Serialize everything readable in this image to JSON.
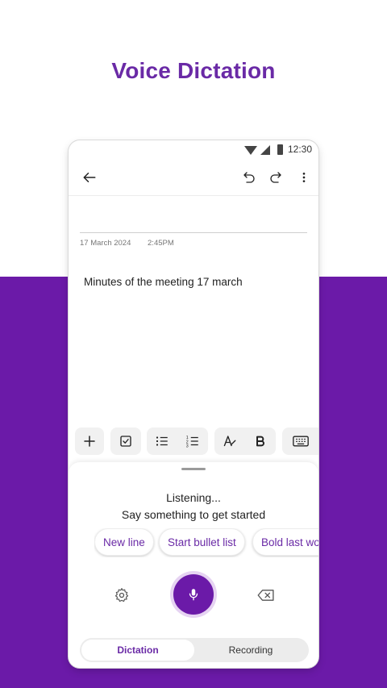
{
  "headline": "Voice Dictation",
  "status_bar": {
    "time": "12:30"
  },
  "note": {
    "date": "17 March 2024",
    "time": "2:45PM",
    "body": "Minutes of the meeting 17 march"
  },
  "dictation": {
    "status": "Listening...",
    "prompt": "Say something to get started",
    "suggestions": [
      "New line",
      "Start bullet list",
      "Bold last wo"
    ]
  },
  "mode_tabs": {
    "active": "Dictation",
    "inactive": "Recording"
  },
  "colors": {
    "brand": "#6b1aa8",
    "accent_text": "#6a2aa6",
    "mic_halo": "#e6d3f2"
  }
}
